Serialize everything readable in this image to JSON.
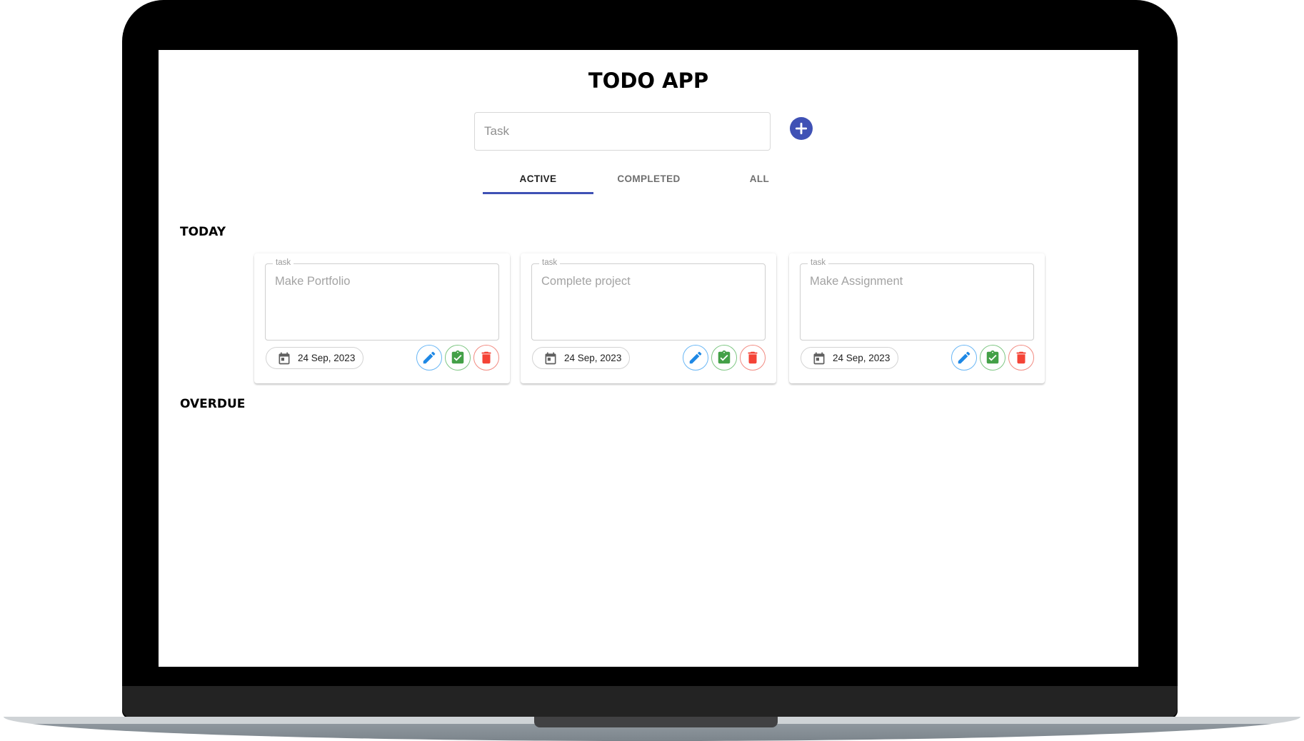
{
  "app": {
    "title": "TODO APP"
  },
  "new_task": {
    "placeholder": "Task",
    "value": "",
    "add_icon": "plus-circle-icon",
    "accent_color": "#3f51b5"
  },
  "tabs": [
    {
      "label": "ACTIVE",
      "selected": true
    },
    {
      "label": "COMPLETED",
      "selected": false
    },
    {
      "label": "ALL",
      "selected": false
    }
  ],
  "sections": {
    "today": {
      "label": "TODAY",
      "tasks": [
        {
          "field_label": "task",
          "text": "Make Portfolio",
          "date": "24 Sep, 2023"
        },
        {
          "field_label": "task",
          "text": "Complete project",
          "date": "24 Sep, 2023"
        },
        {
          "field_label": "task",
          "text": "Make Assignment",
          "date": "24 Sep, 2023"
        }
      ]
    },
    "overdue": {
      "label": "OVERDUE",
      "tasks": []
    }
  },
  "task_actions": {
    "edit_icon": "pencil-icon",
    "complete_icon": "clipboard-check-icon",
    "delete_icon": "trash-icon",
    "date_icon": "calendar-icon",
    "edit_color": "#1e88e5",
    "complete_color": "#43a047",
    "delete_color": "#f44336"
  }
}
